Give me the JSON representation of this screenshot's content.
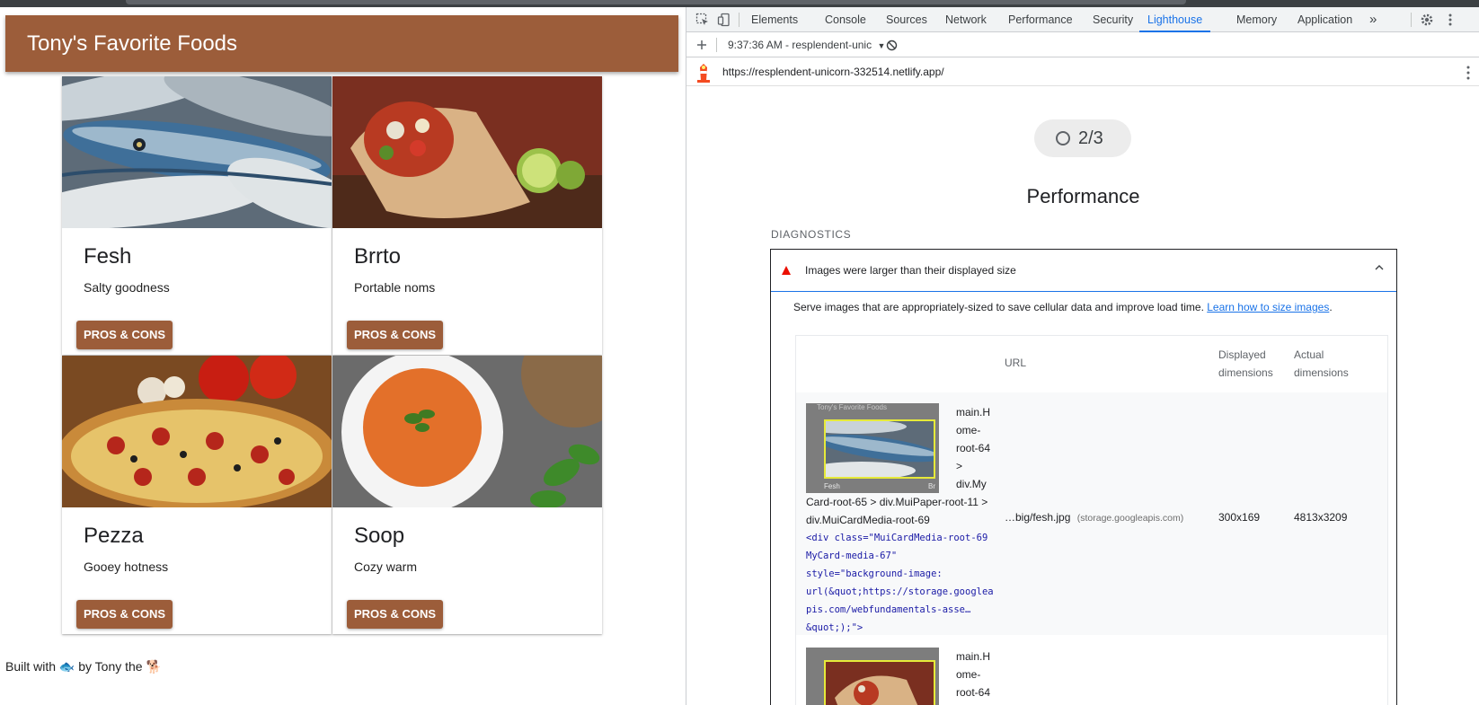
{
  "app": {
    "title": "Tony's Favorite Foods",
    "cards": [
      {
        "title": "Fesh",
        "subtitle": "Salty goodness",
        "button": "PROS & CONS",
        "image": "fish"
      },
      {
        "title": "Brrto",
        "subtitle": "Portable noms",
        "button": "PROS & CONS",
        "image": "burrito"
      },
      {
        "title": "Pezza",
        "subtitle": "Gooey hotness",
        "button": "PROS & CONS",
        "image": "pizza"
      },
      {
        "title": "Soop",
        "subtitle": "Cozy warm",
        "button": "PROS & CONS",
        "image": "soup"
      }
    ],
    "footer": {
      "prefix": "Built with",
      "middle": "by Tony the",
      "emoji1": "🐟",
      "emoji2": "🐕"
    }
  },
  "devtools": {
    "tabs": [
      "Elements",
      "Console",
      "Sources",
      "Network",
      "Performance",
      "Security",
      "Lighthouse",
      "Memory",
      "Application"
    ],
    "active_tab": "Lighthouse",
    "more_tabs": "»",
    "report_selector": "9:37:36 AM - resplendent-unic",
    "url": "https://resplendent-unicorn-332514.netlify.app/",
    "gauge": {
      "value": "2/3"
    },
    "category_title": "Performance",
    "section": "DIAGNOSTICS",
    "audit": {
      "title": "Images were larger than their displayed size",
      "description": "Serve images that are appropriately-sized to save cellular data and improve load time.",
      "link": "Learn how to size images",
      "period": ".",
      "table": {
        "headers": {
          "url": "URL",
          "displayed": "Displayed dimensions",
          "actual": "Actual dimensions"
        },
        "rows": [
          {
            "thumb_caption_top": "Tony's Favorite Foods",
            "thumb_caption_left": "Fesh",
            "thumb_caption_right": "Br",
            "node_lines": [
              "main.H",
              "ome-",
              "root-64",
              ">",
              "div.My",
              "Card-root-65 > div.MuiPaper-root-11 >",
              "div.MuiCardMedia-root-69"
            ],
            "snippet_lines": [
              "<div class=\"MuiCardMedia-root-69",
              "MyCard-media-67\"",
              "style=\"background-image:",
              "url(&quot;https://storage.googlea",
              "pis.com/webfundamentals-asse…",
              "&quot;);\">"
            ],
            "url": "…big/fesh.jpg",
            "host": "(storage.googleapis.com)",
            "displayed": "300x169",
            "actual": "4813x3209"
          },
          {
            "node_lines": [
              "main.H",
              "ome-",
              "root-64"
            ]
          }
        ]
      }
    }
  },
  "colors": {
    "brand": "#9c5d3a",
    "accent": "#1a73e8",
    "fail": "#eb0f00"
  }
}
